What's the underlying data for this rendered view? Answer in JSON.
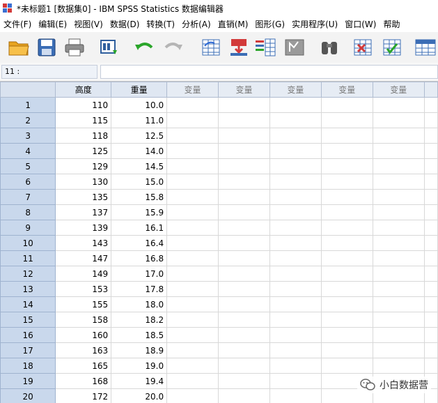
{
  "window": {
    "title": "*未标题1 [数据集0] - IBM SPSS Statistics 数据编辑器"
  },
  "menu": [
    "文件(F)",
    "编辑(E)",
    "视图(V)",
    "数据(D)",
    "转换(T)",
    "分析(A)",
    "直销(M)",
    "图形(G)",
    "实用程序(U)",
    "窗口(W)",
    "帮助"
  ],
  "toolbar": {
    "icons": [
      "open-folder-icon",
      "save-icon",
      "print-icon",
      "recall-dialog-icon",
      "undo-icon",
      "redo-icon",
      "goto-case-icon",
      "goto-variable-icon",
      "variables-icon",
      "run-descriptives-icon",
      "find-icon",
      "insert-cases-icon",
      "insert-variable-icon",
      "split-file-icon"
    ]
  },
  "cellbar": {
    "ref": "11 :",
    "value": ""
  },
  "grid": {
    "columns": [
      "高度",
      "重量",
      "变量",
      "变量",
      "变量",
      "变量",
      "变量"
    ],
    "rows": [
      {
        "n": "1",
        "height": "110",
        "weight": "10.0"
      },
      {
        "n": "2",
        "height": "115",
        "weight": "11.0"
      },
      {
        "n": "3",
        "height": "118",
        "weight": "12.5"
      },
      {
        "n": "4",
        "height": "125",
        "weight": "14.0"
      },
      {
        "n": "5",
        "height": "129",
        "weight": "14.5"
      },
      {
        "n": "6",
        "height": "130",
        "weight": "15.0"
      },
      {
        "n": "7",
        "height": "135",
        "weight": "15.8"
      },
      {
        "n": "8",
        "height": "137",
        "weight": "15.9"
      },
      {
        "n": "9",
        "height": "139",
        "weight": "16.1"
      },
      {
        "n": "10",
        "height": "143",
        "weight": "16.4"
      },
      {
        "n": "11",
        "height": "147",
        "weight": "16.8"
      },
      {
        "n": "12",
        "height": "149",
        "weight": "17.0"
      },
      {
        "n": "13",
        "height": "153",
        "weight": "17.8"
      },
      {
        "n": "14",
        "height": "155",
        "weight": "18.0"
      },
      {
        "n": "15",
        "height": "158",
        "weight": "18.2"
      },
      {
        "n": "16",
        "height": "160",
        "weight": "18.5"
      },
      {
        "n": "17",
        "height": "163",
        "weight": "18.9"
      },
      {
        "n": "18",
        "height": "165",
        "weight": "19.0"
      },
      {
        "n": "19",
        "height": "168",
        "weight": "19.4"
      },
      {
        "n": "20",
        "height": "172",
        "weight": "20.0"
      }
    ]
  },
  "watermark": {
    "text": "小白数据营"
  },
  "colors": {
    "header": "#dfe7f2",
    "rowHeader": "#c9d8ec",
    "accent": "#2f6bd6"
  }
}
